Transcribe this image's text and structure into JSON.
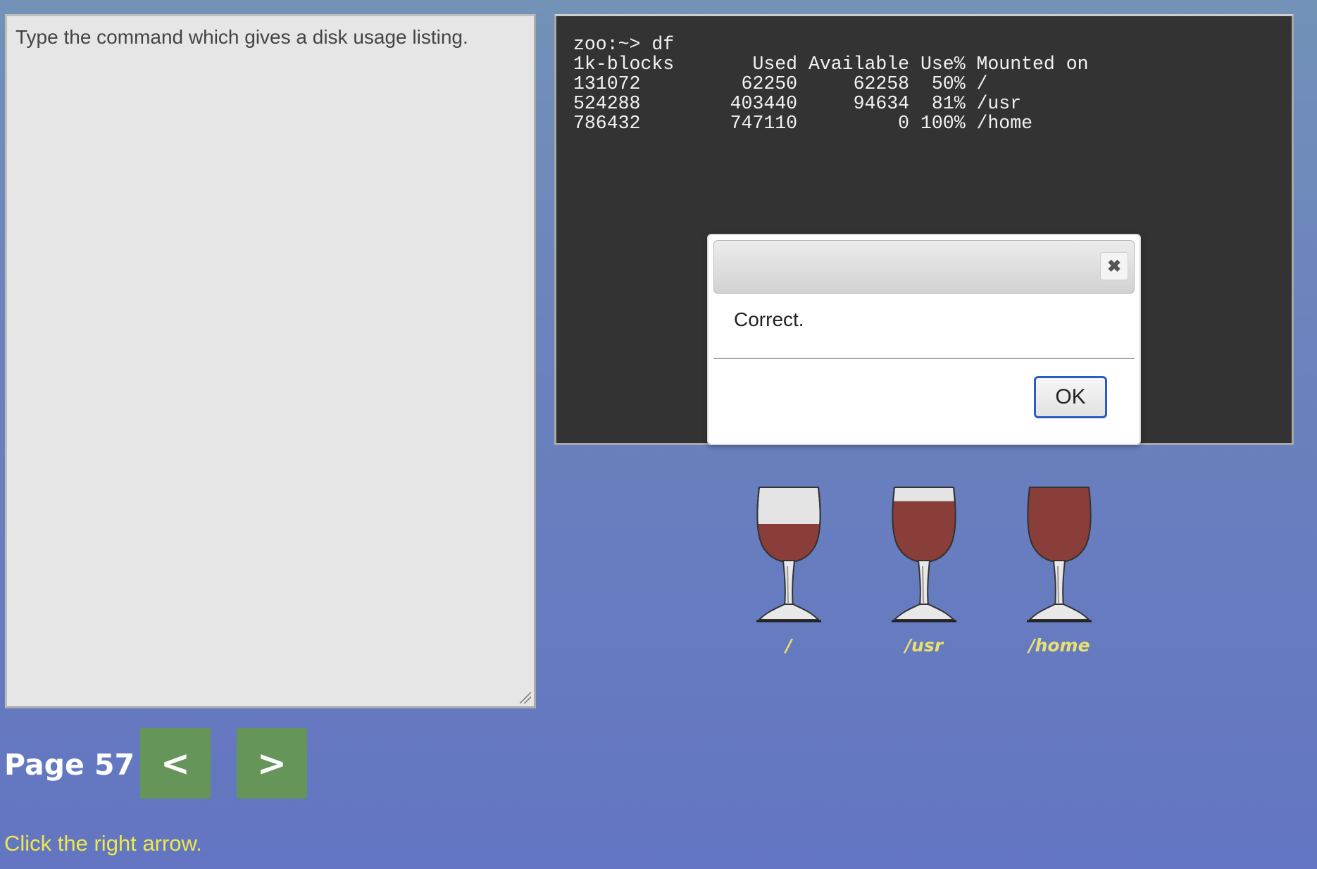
{
  "instructions": {
    "text": "Type the command which gives a disk usage listing."
  },
  "terminal": {
    "lines": [
      "zoo:~> df",
      "1k-blocks       Used Available Use% Mounted on",
      "131072         62250     62258  50% /",
      "524288        403440     94634  81% /usr",
      "786432        747110         0 100% /home"
    ]
  },
  "dialog": {
    "close_icon": "close-icon",
    "message": "Correct.",
    "ok_label": "OK"
  },
  "glasses": [
    {
      "label": "/",
      "fill_fraction": 0.5
    },
    {
      "label": "/usr",
      "fill_fraction": 0.81
    },
    {
      "label": "/home",
      "fill_fraction": 1.0
    }
  ],
  "navigation": {
    "page_label": "Page 57",
    "prev_label": "<",
    "next_label": ">",
    "hint": "Click the right arrow."
  },
  "colors": {
    "wine": "#8a3e3a",
    "label_yellow": "#e8e070",
    "button_green": "#66955a",
    "hint_yellow": "#eee84a"
  }
}
